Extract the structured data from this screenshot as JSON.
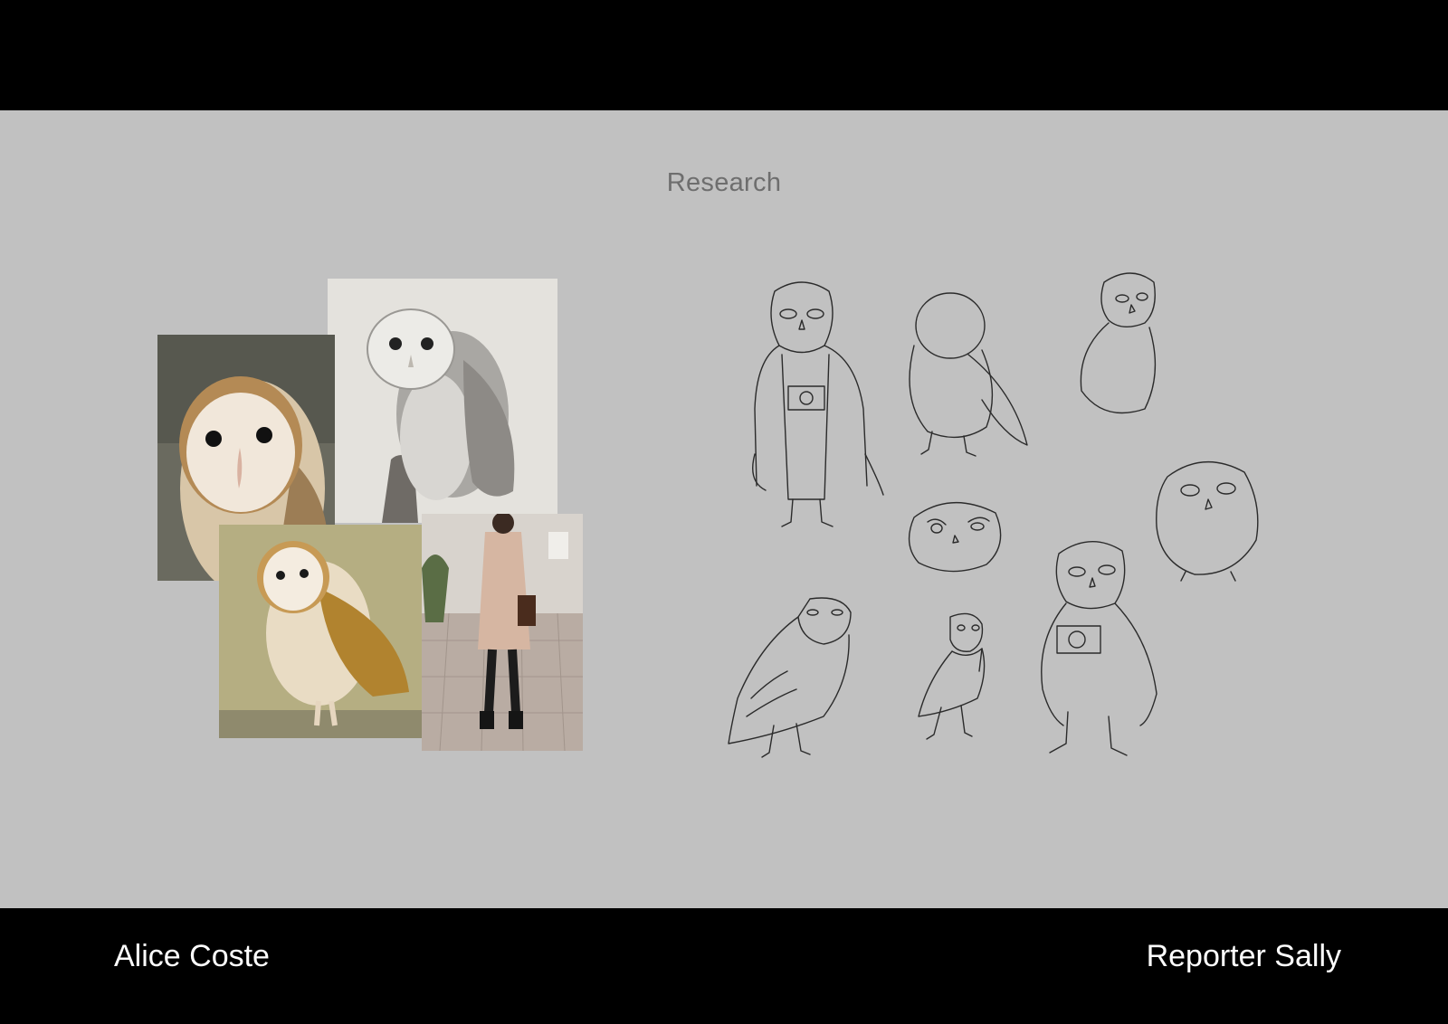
{
  "slide": {
    "title": "Research",
    "author": "Alice Coste",
    "project": "Reporter Sally"
  },
  "colors": {
    "frame": "#000000",
    "panel": "#c1c1c1",
    "title_text": "#6e6e6e",
    "footer_text": "#ffffff",
    "sketch_line": "#2b2b2b"
  },
  "moodboard": {
    "photos": [
      {
        "subject": "barn-owl-face-closeup"
      },
      {
        "subject": "barn-owl-pencil-drawing"
      },
      {
        "subject": "barn-owl-perched-golden"
      },
      {
        "subject": "woman-in-beige-coat"
      }
    ]
  },
  "sketches": {
    "items": [
      {
        "subject": "owl-reporter-with-camera-coat"
      },
      {
        "subject": "owl-body-construction"
      },
      {
        "subject": "owl-side-glance"
      },
      {
        "subject": "owl-round-head-study"
      },
      {
        "subject": "owl-face-expression"
      },
      {
        "subject": "owl-walking-side-view"
      },
      {
        "subject": "small-owl-with-scarf"
      },
      {
        "subject": "owl-reporter-with-camera"
      }
    ]
  }
}
